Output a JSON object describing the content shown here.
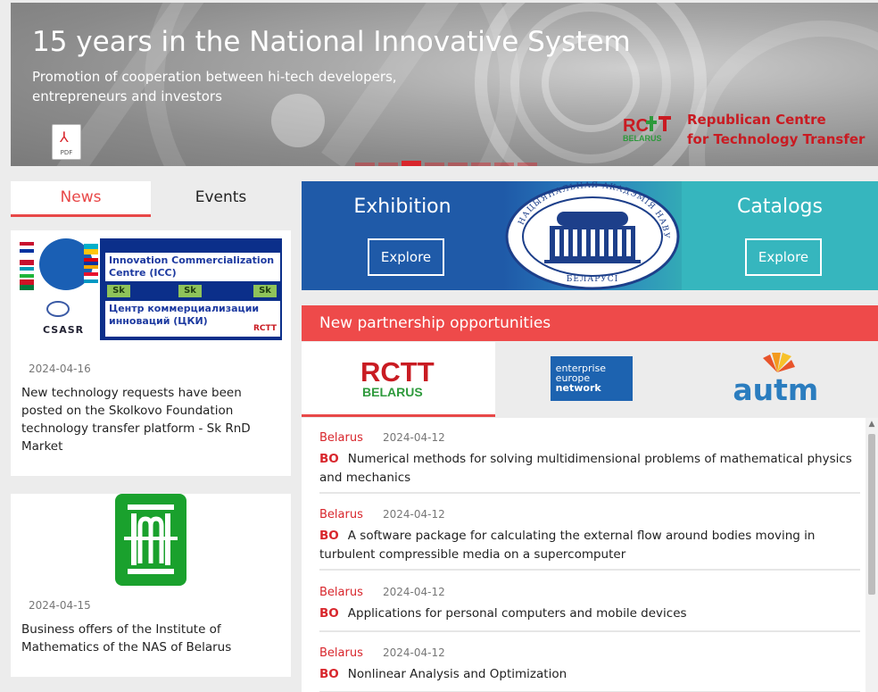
{
  "hero": {
    "title": "15 years in the National Innovative System",
    "subtitle": "Promotion of cooperation between hi-tech developers, entrepreneurs and investors",
    "pdf_label": "PDF",
    "org_name_line1": "Republican Centre",
    "org_name_line2": "for Technology Transfer",
    "logo_text_top": "RCTT",
    "logo_text_bottom": "BELARUS",
    "slide_count": 8,
    "active_slide": 3
  },
  "left": {
    "tabs": [
      {
        "label": "News",
        "active": true
      },
      {
        "label": "Events",
        "active": false
      }
    ],
    "news": [
      {
        "date": "2024-04-16",
        "title": "New technology requests have been posted on the Skolkovo Foundation technology transfer platform - Sk RnD Market",
        "image": {
          "line1": "Innovation Commercialization Centre (ICC)",
          "sk": "Sk",
          "line2": "Центр коммерциализации инноваций (ЦКИ)",
          "csasr": "CSASR",
          "rctt": "RCTT"
        }
      },
      {
        "date": "2024-04-15",
        "title": "Business offers of the Institute of Mathematics of the NAS of Belarus"
      }
    ]
  },
  "promo": {
    "exhibition_title": "Exhibition",
    "exhibition_button": "Explore",
    "catalogs_title": "Catalogs",
    "catalogs_button": "Explore",
    "seal_top": "НАЦЫЯНАЛЬНАЯ АКАДЭМІЯ НАВУК",
    "seal_bottom": "БЕЛАРУСІ"
  },
  "partners": {
    "heading": "New partnership opportunities",
    "logos": [
      {
        "name": "RCTT",
        "sub": "BELARUS",
        "active": true
      },
      {
        "line1": "enterprise",
        "line2": "europe",
        "line3": "network",
        "active": false
      },
      {
        "name": "autm",
        "active": false
      }
    ]
  },
  "opportunities": [
    {
      "country": "Belarus",
      "date": "2024-04-12",
      "type": "BO",
      "title": "Numerical methods for solving multidimensional problems of mathematical physics and mechanics"
    },
    {
      "country": "Belarus",
      "date": "2024-04-12",
      "type": "BO",
      "title": "A software package for calculating the external flow around bodies moving in turbulent compressible media on a supercomputer"
    },
    {
      "country": "Belarus",
      "date": "2024-04-12",
      "type": "BO",
      "title": "Applications for personal computers and mobile devices"
    },
    {
      "country": "Belarus",
      "date": "2024-04-12",
      "type": "BO",
      "title": "Nonlinear Analysis and Optimization"
    }
  ],
  "colors": {
    "accent_red": "#e84848",
    "promo_blue": "#1f5aa8",
    "promo_teal": "#36b6be",
    "brand_red": "#d8262c"
  }
}
